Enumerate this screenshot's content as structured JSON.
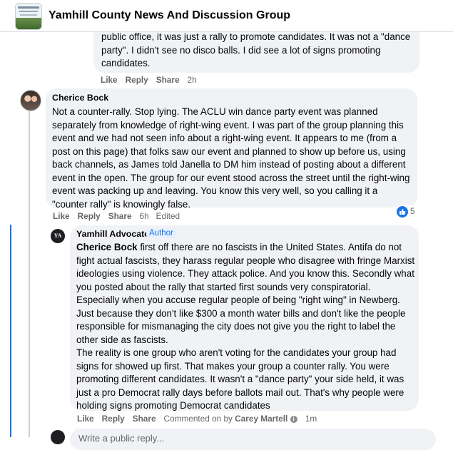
{
  "header": {
    "group_title": "Yamhill County News And Discussion Group"
  },
  "comments": [
    {
      "text": "public office, it was just a rally to promote candidates. It was not a \"dance party\". I didn't see no disco balls. I did see a lot of signs promoting candidates.",
      "actions": {
        "like": "Like",
        "reply": "Reply",
        "share": "Share",
        "time": "2h"
      }
    },
    {
      "author": "Cherice Bock",
      "text": "Not a counter-rally. Stop lying. The ACLU win dance party event was planned separately from knowledge of right-wing event. I was part of the group planning this event and we had not seen info about a right-wing event. It appears to me (from a post on this page) that folks saw our event and planned to show up before us, using back channels, as James told Janella to DM him instead of posting about a different event in the open. The group for our event stood across the street until the right-wing event was packing up and leaving. You know this very well, so you calling it a \"counter rally\" is knowingly false.",
      "actions": {
        "like": "Like",
        "reply": "Reply",
        "share": "Share",
        "time": "6h",
        "edited": "Edited"
      },
      "reaction_count": "5"
    },
    {
      "author": "Yamhill Advocate",
      "badge": "Author",
      "avatar_text": "YA",
      "mention": "Cherice Bock",
      "text": " first off there are no fascists in the United States. Antifa do not fight actual fascists, they harass regular people who disagree with fringe Marxist ideologies using violence. They attack police. And you know this. Secondly what you posted about the rally that started first sounds very conspiratorial. Especially when you accuse regular people of being \"right wing\" in Newberg. Just because they don't like $300 a month water bills and don't like the people responsible for mismanaging the city does not give you the right to label the other side as fascists.",
      "text2": "The reality is one group who aren't voting for the candidates your group had signs for showed up first. That makes your group a counter rally. You were promoting different candidates. It wasn't a \"dance party\" your side held, it was just a pro Democrat rally days before ballots mail out. That's why people were holding signs promoting Democrat candidates",
      "actions": {
        "like": "Like",
        "reply": "Reply",
        "share": "Share",
        "commented_on_by": "Commented on by",
        "commenter": "Carey Martell",
        "time": "1m"
      }
    }
  ],
  "composer": {
    "placeholder": "Write a public reply..."
  },
  "colors": {
    "accent": "#1b74e4",
    "bubble": "#f0f2f5",
    "meta": "#65676b"
  }
}
